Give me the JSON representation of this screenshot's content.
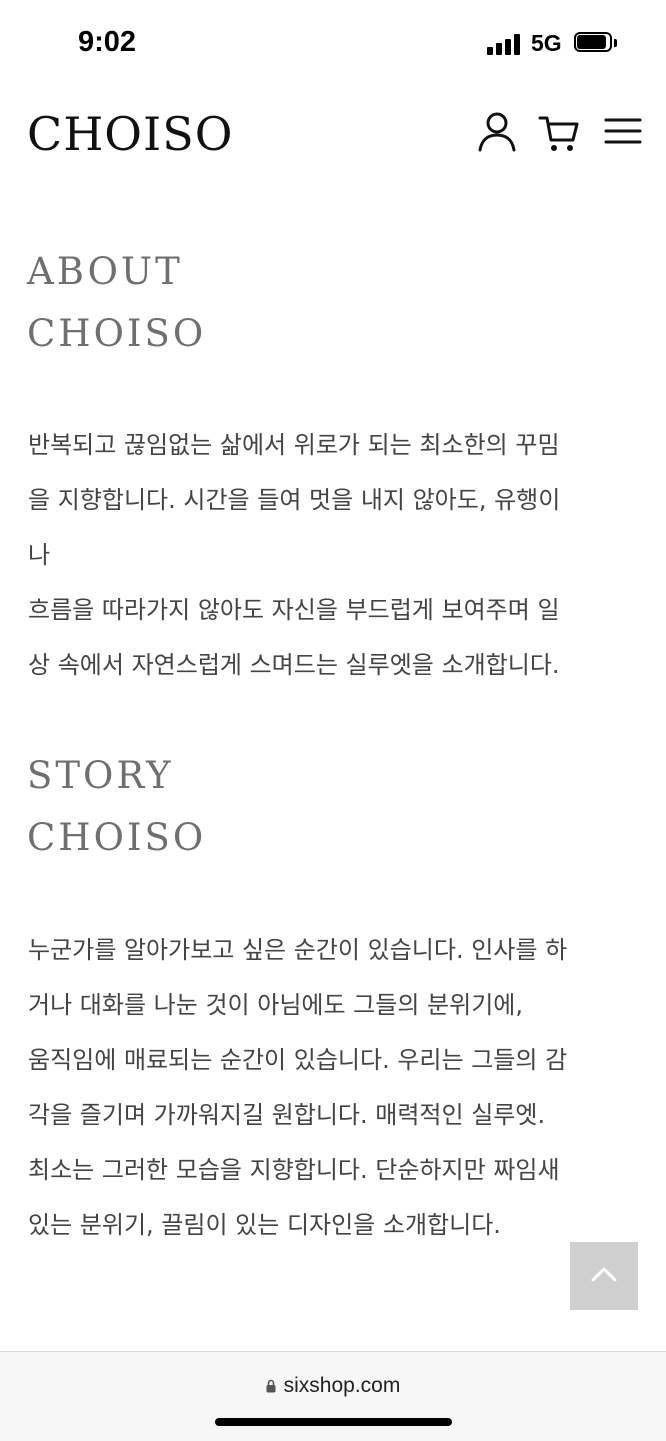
{
  "status_bar": {
    "time": "9:02",
    "network": "5G",
    "icons": [
      "signal-icon",
      "battery-icon"
    ]
  },
  "header": {
    "logo": "CHOISO",
    "icons": [
      "user-icon",
      "cart-icon",
      "menu-icon"
    ]
  },
  "about": {
    "title_lines": [
      "ABOUT",
      "CHOISO"
    ],
    "lines": [
      "반복되고 끊임없는 삶에서 위로가 되는 최소한의 꾸밈",
      "을 지향합니다. 시간을 들여 멋을 내지 않아도, 유행이",
      "나",
      "흐름을 따라가지 않아도 자신을 부드럽게 보여주며 일",
      "상 속에서 자연스럽게 스며드는 실루엣을 소개합니다."
    ]
  },
  "story": {
    "title_lines": [
      "STORY",
      "CHOISO"
    ],
    "lines": [
      "누군가를 알아가보고 싶은 순간이 있습니다. 인사를 하",
      "거나 대화를 나눈 것이 아님에도 그들의 분위기에,",
      "움직임에 매료되는 순간이 있습니다. 우리는 그들의 감",
      "각을 즐기며 가까워지길 원합니다. 매력적인 실루엣.",
      "최소는 그러한 모습을 지향합니다. 단순하지만 짜임새",
      "있는 분위기, 끌림이 있는 디자인을 소개합니다."
    ]
  },
  "scroll_top": {
    "icon": "chevron-up-icon"
  },
  "browser": {
    "url": "sixshop.com",
    "icon": "lock-icon"
  }
}
